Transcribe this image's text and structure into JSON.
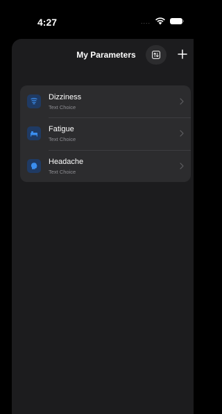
{
  "status_bar": {
    "time": "4:27",
    "signal_dots": "....",
    "wifi_icon": "wifi-icon",
    "battery_icon": "battery-icon"
  },
  "header": {
    "title": "My Parameters",
    "sort_icon": "sort-icon",
    "add_icon": "plus-icon"
  },
  "parameters": [
    {
      "title": "Dizziness",
      "type": "Text Choice",
      "icon": "dizzy-icon"
    },
    {
      "title": "Fatigue",
      "type": "Text Choice",
      "icon": "bed-icon"
    },
    {
      "title": "Headache",
      "type": "Text Choice",
      "icon": "head-icon"
    }
  ],
  "colors": {
    "background": "#000000",
    "sheet": "#1c1c1e",
    "card": "#2c2c2e",
    "icon_bg": "#1f3a63",
    "accent": "#3a8ef0",
    "secondary_text": "#8e8e93"
  }
}
